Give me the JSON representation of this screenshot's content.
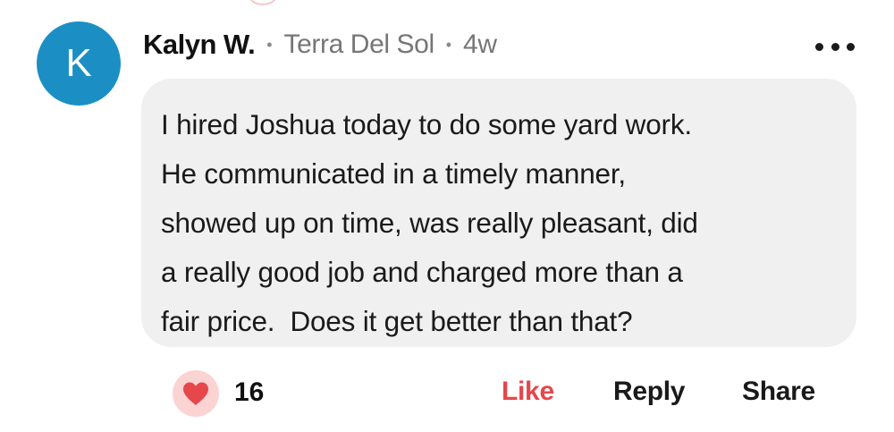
{
  "comment": {
    "avatar_letter": "K",
    "author": "Kalyn W.",
    "separator": "•",
    "neighborhood": "Terra Del Sol",
    "time_ago": "4w",
    "text": "I hired Joshua today to do some yard work.\nHe communicated in a timely manner,\nshowed up on time, was really pleasant, did\na really good job and charged more than a\nfair price.  Does it get better than that?"
  },
  "reactions": {
    "icon": "heart-icon",
    "count": "16"
  },
  "actions": {
    "like_label": "Like",
    "reply_label": "Reply",
    "share_label": "Share"
  },
  "colors": {
    "avatar_bg": "#1b8fc4",
    "bubble_bg": "#f0f0f1",
    "like_active": "#e5474a",
    "heart": "#e5474a",
    "heart_bg": "#fbd3d3"
  }
}
